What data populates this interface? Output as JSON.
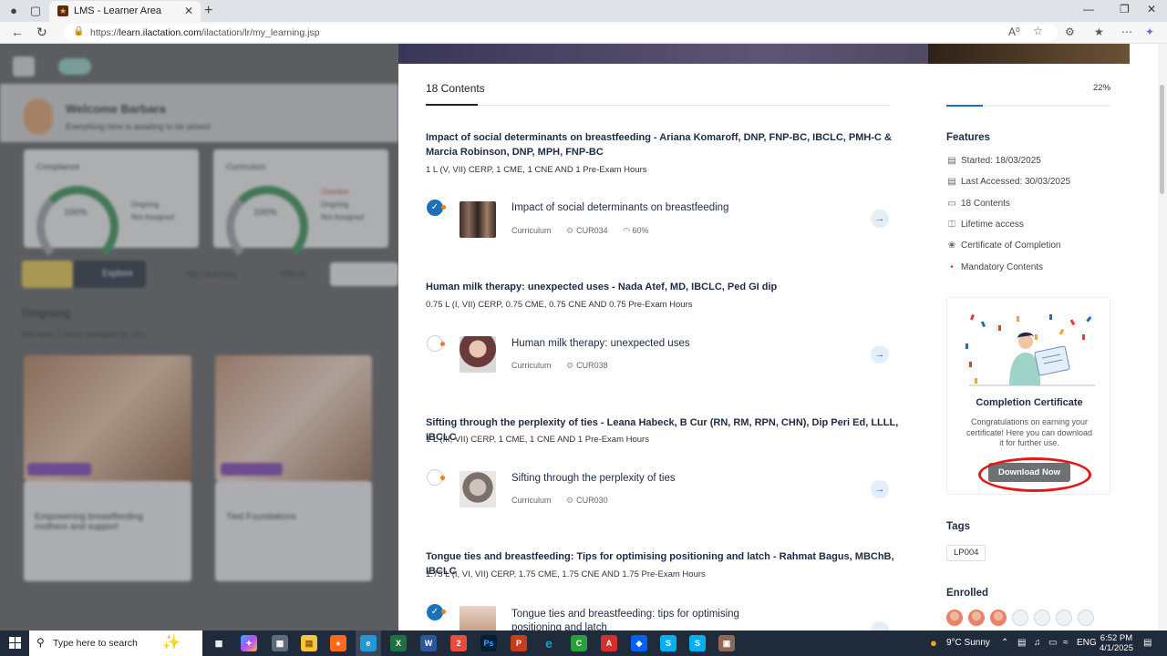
{
  "browser": {
    "tab_title": "LMS - Learner Area",
    "url_prefix": "https://",
    "url_host": "learn.ilactation.com",
    "url_path": "/ilactation/lr/my_learning.jsp"
  },
  "background": {
    "welcome": "Welcome Barbara",
    "subtitle": "Everything here is awaiting to be picked",
    "stat1": "Compliance",
    "stat2": "Curriculum",
    "gauge1": "100%",
    "gauge2": "100%",
    "b1": "Ongoing",
    "b2": "Overdue",
    "b3": "Not Assigned",
    "search_tab": "Explore",
    "my_learning": "My Learning",
    "filters": "Filters",
    "ongoing": "Ongoing",
    "ongoing_sub": "We have 2 items available for you",
    "card1": "Empowering breastfeeding mothers and support",
    "card2": "Tied Foundations"
  },
  "drawer": {
    "contents_tab": "18 Contents",
    "modules": [
      {
        "title": "Impact of social determinants on breastfeeding - Ariana Komaroff, DNP, FNP-BC, IBCLC, PMH-C & Marcia Robinson, DNP, MPH, FNP-BC",
        "credits": "1 L (V, VII) CERP, 1 CME, 1 CNE AND 1 Pre-Exam Hours",
        "item_title": "Impact of social determinants on breastfeeding",
        "type": "Curriculum",
        "code": "CUR034",
        "progress": "60%",
        "completed": true
      },
      {
        "title": "Human milk therapy: unexpected uses - Nada Atef, MD, IBCLC, Ped GI dip",
        "credits": "0.75 L (I, VII) CERP, 0.75 CME, 0.75 CNE AND 0.75 Pre-Exam Hours",
        "item_title": "Human milk therapy: unexpected uses",
        "type": "Curriculum",
        "code": "CUR038",
        "completed": false
      },
      {
        "title": "Sifting through the perplexity of ties - Leana Habeck, B Cur (RN, RM, RPN, CHN), Dip Peri Ed, LLLL, IBCLC",
        "credits": "1 L (III, VII) CERP, 1 CME, 1 CNE AND 1 Pre-Exam Hours",
        "item_title": "Sifting through the perplexity of ties",
        "type": "Curriculum",
        "code": "CUR030",
        "completed": false
      },
      {
        "title": "Tongue ties and breastfeeding: Tips for optimising positioning and latch - Rahmat Bagus, MBChB, IBCLC",
        "credits": "1.75 L (I, VI, VII) CERP, 1.75 CME, 1.75 CNE AND 1.75 Pre-Exam Hours",
        "item_title_line1": "Tongue ties and breastfeeding: tips for optimising",
        "item_title_line2": "positioning and latch",
        "completed": true
      }
    ],
    "progress_pct": "22%",
    "progress_value": 0.22,
    "features_heading": "Features",
    "features": {
      "started": "Started: 18/03/2025",
      "last_accessed": "Last Accessed: 30/03/2025",
      "contents": "18 Contents",
      "access": "Lifetime access",
      "certificate": "Certificate of Completion",
      "mandatory": "Mandatory Contents"
    },
    "certificate_card": {
      "title": "Completion Certificate",
      "text": "Congratulations on earning your certificate! Here you can download it for further use.",
      "button": "Download Now"
    },
    "tags_heading": "Tags",
    "tag": "LP004",
    "enrolled_heading": "Enrolled"
  },
  "taskbar": {
    "search_placeholder": "Type here to search",
    "weather": "9°C  Sunny",
    "lang": "ENG",
    "time": "6:52 PM",
    "date": "4/1/2025"
  },
  "colors": {
    "accent": "#1c6fb9",
    "highlight_ring": "#e01a1a"
  }
}
